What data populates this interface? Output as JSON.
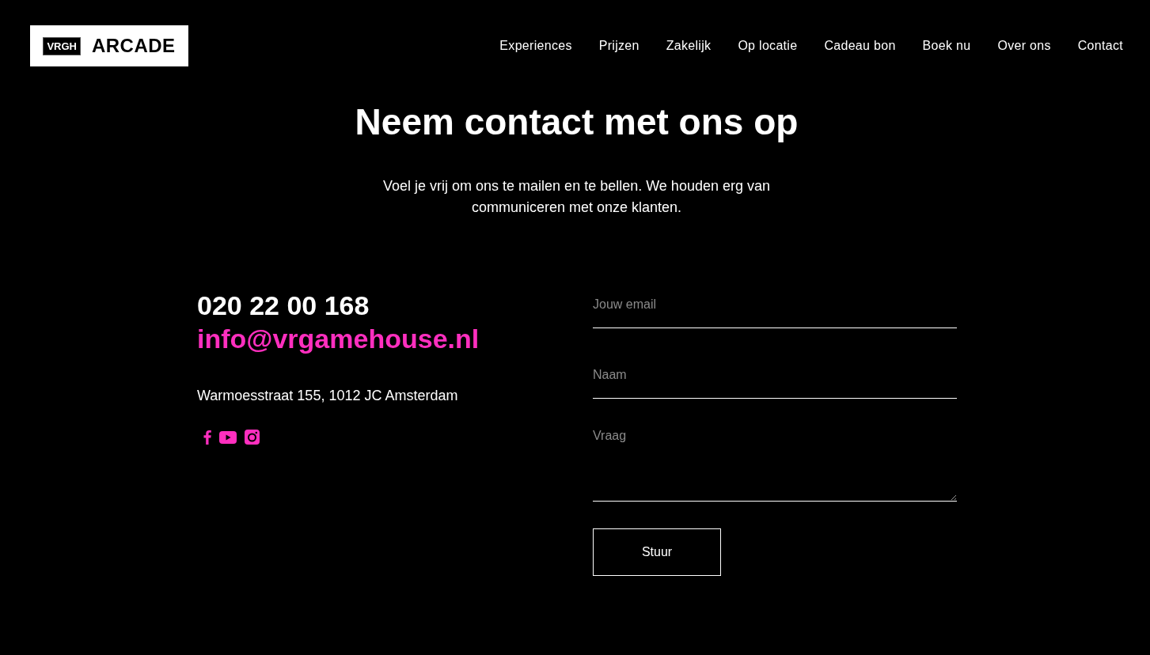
{
  "logo": {
    "badge": "VRGH",
    "name": "ARCADE"
  },
  "nav": [
    {
      "label": "Experiences"
    },
    {
      "label": "Prijzen"
    },
    {
      "label": "Zakelijk"
    },
    {
      "label": "Op locatie"
    },
    {
      "label": "Cadeau bon"
    },
    {
      "label": "Boek nu"
    },
    {
      "label": "Over ons"
    },
    {
      "label": "Contact"
    }
  ],
  "heading": "Neem contact met ons op",
  "intro": "Voel je vrij om ons te mailen en te bellen. We houden erg van communiceren met onze klanten.",
  "contact": {
    "phone": "020 22 00 168",
    "email": "info@vrgamehouse.nl",
    "address": "Warmoesstraat 155, 1012 JC Amsterdam"
  },
  "social": [
    {
      "kind": "facebook"
    },
    {
      "kind": "youtube"
    },
    {
      "kind": "instagram"
    }
  ],
  "form": {
    "fields": [
      {
        "kind": "input",
        "placeholder": "Jouw email"
      },
      {
        "kind": "input",
        "placeholder": "Naam"
      },
      {
        "kind": "textarea",
        "placeholder": "Vraag"
      }
    ],
    "submit": "Stuur"
  }
}
